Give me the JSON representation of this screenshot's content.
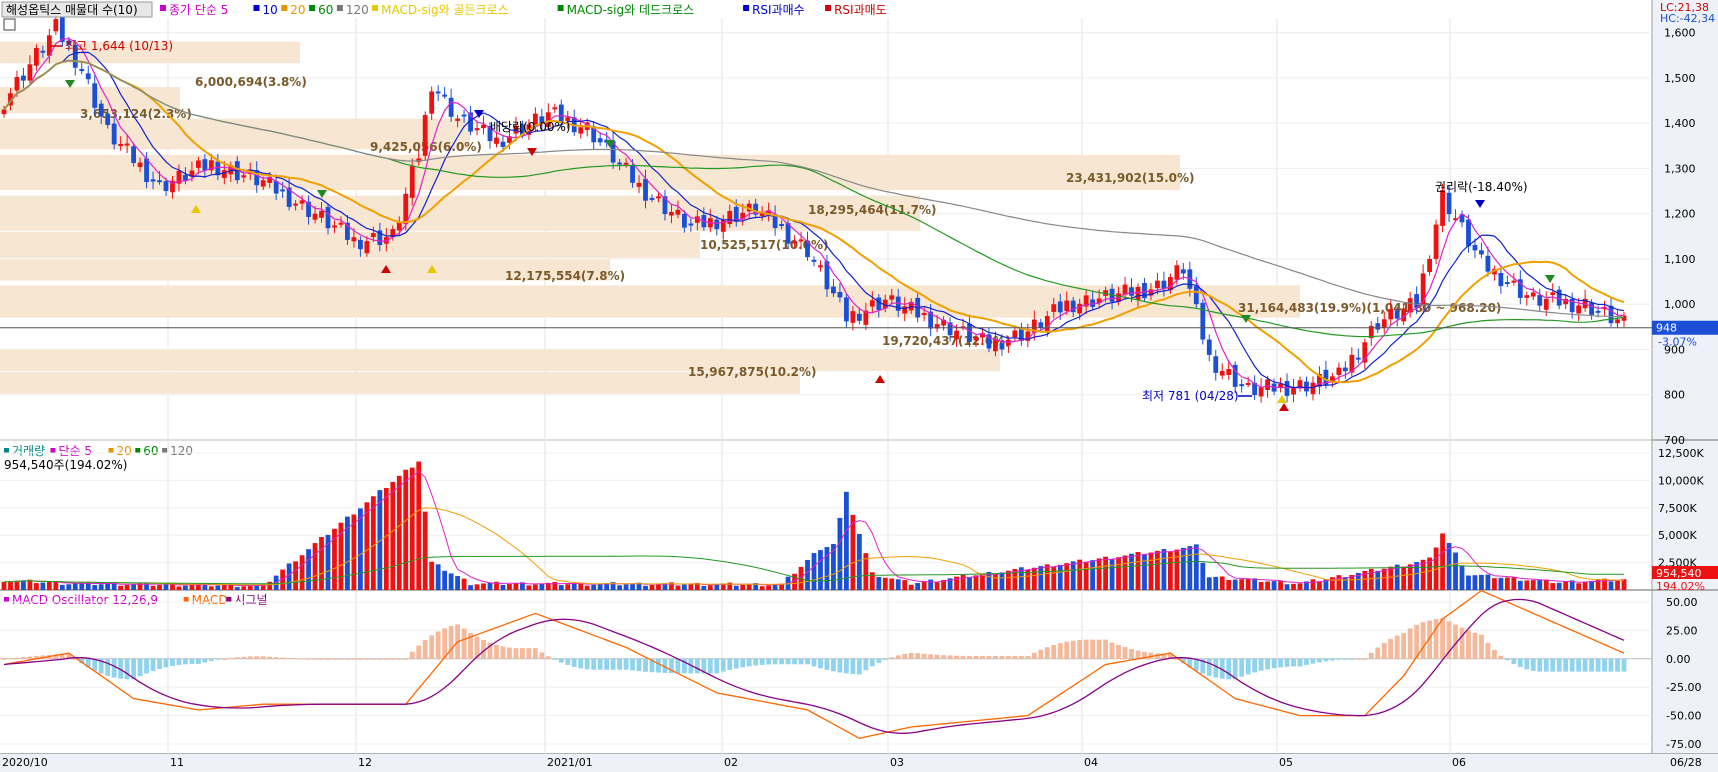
{
  "legend": {
    "title": "해성옵틱스 매물대 수(10)",
    "items": [
      {
        "label": "종가 단순 5",
        "color": "#cc00cc"
      },
      {
        "label": "10",
        "color": "#0000cc"
      },
      {
        "label": "20",
        "color": "#e69500"
      },
      {
        "label": "60",
        "color": "#008800"
      },
      {
        "label": "120",
        "color": "#777777"
      },
      {
        "label": "MACD-sig와 골든크로스",
        "color": "#e6c800"
      },
      {
        "label": "MACD-sig와 데드크로스",
        "color": "#008800"
      },
      {
        "label": "RSI과매수",
        "color": "#0000cc"
      },
      {
        "label": "RSI과매도",
        "color": "#cc0000"
      }
    ],
    "lc": "LC:21,38",
    "hc": "HC:-42,34"
  },
  "price_panel": {
    "y_ticks": [
      "1,600",
      "1,500",
      "1,400",
      "1,300",
      "1,200",
      "1,100",
      "1,000",
      "900",
      "800",
      "700"
    ],
    "high_label": "최고 1,644 (10/13)",
    "low_label": "최저 781 (04/28)",
    "current_price": "948",
    "change_pct": "-3.07%",
    "annotations": [
      "배당락(0.00%)",
      "권리락(-18.40%)"
    ],
    "volume_profile_labels": [
      "6,000,694(3.8%)",
      "3,653,124(2.3%)",
      "9,425,056(6.0%)",
      "23,431,902(15.0%)",
      "18,295,464(11.7%)",
      "10,525,517(10.0%)",
      "12,175,554(7.8%)",
      "19,720,437(12.6%)",
      "31,164,483(19.9%)(1,041.80 ~ 968.20)",
      "15,967,875(10.2%)"
    ]
  },
  "volume_panel": {
    "legend": [
      {
        "label": "거래량",
        "color": "#008888"
      },
      {
        "label": "단순 5",
        "color": "#cc00cc"
      },
      {
        "label": "20",
        "color": "#e69500"
      },
      {
        "label": "60",
        "color": "#008800"
      },
      {
        "label": "120",
        "color": "#777777"
      }
    ],
    "current_label": "954,540주(194.02%)",
    "y_ticks": [
      "12,500K",
      "10,000K",
      "7,500K",
      "5,000K",
      "2,500K"
    ],
    "badge_value": "954,540",
    "badge_pct": "194.02%"
  },
  "macd_panel": {
    "legend": [
      {
        "label": "MACD Oscillator 12,26,9",
        "color": "#cc00cc"
      },
      {
        "label": "MACD",
        "color": "#ff6600"
      },
      {
        "label": "시그널",
        "color": "#880088"
      }
    ],
    "y_ticks": [
      "50.00",
      "25.00",
      "0.00",
      "-25.00",
      "-50.00",
      "-75.00"
    ]
  },
  "x_axis": {
    "labels": [
      "2020/10",
      "11",
      "12",
      "2021/01",
      "02",
      "03",
      "04",
      "05",
      "06",
      "06/28"
    ]
  },
  "colors": {
    "up": "#ee1111",
    "down": "#1a4fd6",
    "profile": "#f7e6d2"
  },
  "chart_data": {
    "type": "candlestick",
    "title": "해성옵틱스 매물대 수(10)",
    "y_range": [
      700,
      1650
    ],
    "volume_range_k": [
      0,
      12500
    ],
    "macd_range": [
      -75,
      50
    ],
    "x_labels": [
      "2020/10",
      "11",
      "12",
      "2021/01",
      "02",
      "03",
      "04",
      "05",
      "06",
      "06/28"
    ],
    "high": 1644,
    "low": 781,
    "last_close": 948,
    "last_volume": 954540,
    "volume_profile": [
      {
        "label": "15,967,875(10.2%)",
        "from": 800,
        "to": 850
      },
      {
        "label": "19,720,437(12.6%)",
        "from": 850,
        "to": 900
      },
      {
        "label": "31,164,483(19.9%)(1,041.80 ~ 968.20)",
        "from": 968.2,
        "to": 1041.8
      },
      {
        "label": "12,175,554(7.8%)",
        "from": 1050,
        "to": 1100
      },
      {
        "label": "10,525,517(10.0%)",
        "from": 1100,
        "to": 1160
      },
      {
        "label": "18,295,464(11.7%)",
        "from": 1160,
        "to": 1240
      },
      {
        "label": "23,431,902(15.0%)",
        "from": 1250,
        "to": 1330
      },
      {
        "label": "9,425,056(6.0%)",
        "from": 1340,
        "to": 1410
      },
      {
        "label": "3,653,124(2.3%)",
        "from": 1420,
        "to": 1480
      },
      {
        "label": "6,000,694(3.8%)",
        "from": 1530,
        "to": 1580
      }
    ],
    "anchors_price": [
      [
        0,
        1450
      ],
      [
        8,
        1610
      ],
      [
        12,
        1520
      ],
      [
        16,
        1380
      ],
      [
        24,
        1260
      ],
      [
        32,
        1310
      ],
      [
        40,
        1270
      ],
      [
        48,
        1200
      ],
      [
        54,
        1140
      ],
      [
        60,
        1150
      ],
      [
        64,
        1330
      ],
      [
        66,
        1490
      ],
      [
        70,
        1410
      ],
      [
        76,
        1360
      ],
      [
        84,
        1420
      ],
      [
        90,
        1390
      ],
      [
        98,
        1260
      ],
      [
        106,
        1170
      ],
      [
        116,
        1210
      ],
      [
        124,
        1120
      ],
      [
        130,
        970
      ],
      [
        136,
        1010
      ],
      [
        144,
        960
      ],
      [
        152,
        910
      ],
      [
        158,
        940
      ],
      [
        164,
        1000
      ],
      [
        172,
        1020
      ],
      [
        178,
        1040
      ],
      [
        182,
        1080
      ],
      [
        186,
        880
      ],
      [
        192,
        810
      ],
      [
        200,
        820
      ],
      [
        206,
        840
      ],
      [
        212,
        960
      ],
      [
        218,
        1000
      ],
      [
        222,
        1240
      ],
      [
        228,
        1090
      ],
      [
        236,
        1010
      ],
      [
        244,
        1000
      ],
      [
        250,
        955
      ]
    ],
    "anchors_volume_k": [
      [
        0,
        900
      ],
      [
        10,
        600
      ],
      [
        40,
        400
      ],
      [
        64,
        11800
      ],
      [
        66,
        2500
      ],
      [
        72,
        600
      ],
      [
        120,
        500
      ],
      [
        126,
        3800
      ],
      [
        128,
        4200
      ],
      [
        130,
        8800
      ],
      [
        134,
        1500
      ],
      [
        140,
        600
      ],
      [
        184,
        4000
      ],
      [
        186,
        1200
      ],
      [
        200,
        600
      ],
      [
        216,
        2300
      ],
      [
        220,
        2800
      ],
      [
        222,
        5200
      ],
      [
        226,
        1400
      ],
      [
        240,
        700
      ],
      [
        250,
        950
      ]
    ],
    "anchors_macd": [
      [
        0,
        -5
      ],
      [
        10,
        5
      ],
      [
        20,
        -35
      ],
      [
        30,
        -45
      ],
      [
        40,
        -40
      ],
      [
        62,
        -40
      ],
      [
        70,
        15
      ],
      [
        82,
        40
      ],
      [
        96,
        10
      ],
      [
        110,
        -30
      ],
      [
        124,
        -45
      ],
      [
        132,
        -70
      ],
      [
        140,
        -60
      ],
      [
        158,
        -50
      ],
      [
        170,
        -5
      ],
      [
        180,
        5
      ],
      [
        190,
        -35
      ],
      [
        200,
        -50
      ],
      [
        210,
        -50
      ],
      [
        216,
        -15
      ],
      [
        222,
        35
      ],
      [
        228,
        60
      ],
      [
        236,
        40
      ],
      [
        250,
        5
      ]
    ]
  }
}
